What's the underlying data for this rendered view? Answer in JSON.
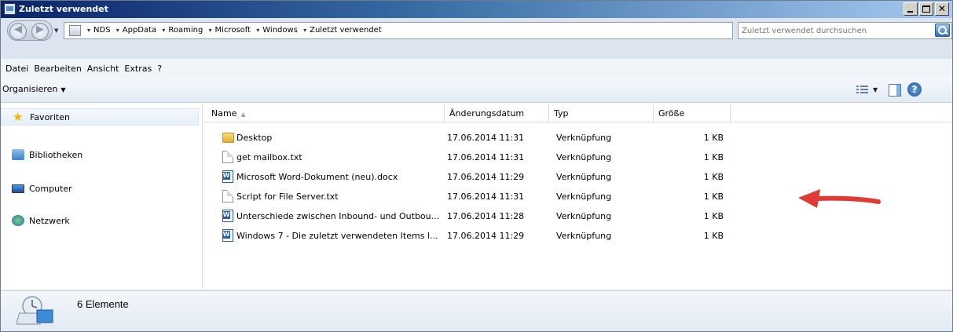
{
  "window": {
    "title": "Zuletzt verwendet"
  },
  "address": {
    "breadcrumbs": [
      "NDS",
      "AppData",
      "Roaming",
      "Microsoft",
      "Windows",
      "Zuletzt verwendet"
    ],
    "search_placeholder": "Zuletzt verwendet durchsuchen"
  },
  "menu": [
    "Datei",
    "Bearbeiten",
    "Ansicht",
    "Extras",
    "?"
  ],
  "toolbar": {
    "organize_label": "Organisieren"
  },
  "nav": {
    "favorites": "Favoriten",
    "libraries": "Bibliotheken",
    "computer": "Computer",
    "network": "Netzwerk"
  },
  "columns": {
    "name": "Name",
    "date": "Änderungsdatum",
    "type": "Typ",
    "size": "Größe"
  },
  "files": [
    {
      "name": "Desktop",
      "date": "17.06.2014 11:31",
      "type": "Verknüpfung",
      "size": "1 KB",
      "icon": "folder-icon"
    },
    {
      "name": "get mailbox.txt",
      "date": "17.06.2014 11:31",
      "type": "Verknüpfung",
      "size": "1 KB",
      "icon": "text-file-icon"
    },
    {
      "name": "Microsoft Word-Dokument (neu).docx",
      "date": "17.06.2014 11:29",
      "type": "Verknüpfung",
      "size": "1 KB",
      "icon": "word-document-icon"
    },
    {
      "name": "Script for File Server.txt",
      "date": "17.06.2014 11:31",
      "type": "Verknüpfung",
      "size": "1 KB",
      "icon": "text-file-icon"
    },
    {
      "name": "Unterschiede zwischen Inbound- und Outbou...",
      "date": "17.06.2014 11:28",
      "type": "Verknüpfung",
      "size": "1 KB",
      "icon": "word-document-icon"
    },
    {
      "name": "Windows 7 - Die zuletzt verwendeten Items l...",
      "date": "17.06.2014 11:29",
      "type": "Verknüpfung",
      "size": "1 KB",
      "icon": "word-document-icon"
    }
  ],
  "status": {
    "count": "6 Elemente"
  },
  "colors": {
    "annotation_arrow": "#e03a35",
    "titlebar_start": "#0a246a",
    "titlebar_end": "#a6caf0"
  }
}
